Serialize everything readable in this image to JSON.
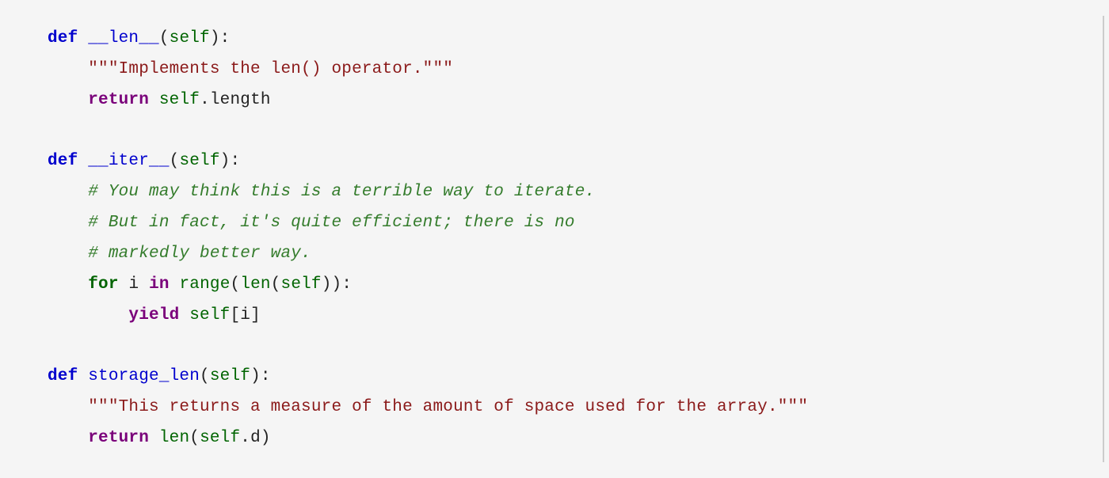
{
  "code": {
    "lines": [
      {
        "indent": 0,
        "tokens": [
          {
            "cls": "tok-def",
            "bind": "code.kw.def"
          },
          {
            "cls": "tok-var",
            "raw": " "
          },
          {
            "cls": "tok-funcname",
            "bind": "code.funcs.len"
          },
          {
            "cls": "tok-paren",
            "raw": "("
          },
          {
            "cls": "tok-self",
            "bind": "code.kw.self"
          },
          {
            "cls": "tok-paren",
            "raw": "):"
          }
        ]
      },
      {
        "indent": 1,
        "tokens": [
          {
            "cls": "tok-docstring",
            "bind": "code.docstrings.len"
          }
        ]
      },
      {
        "indent": 1,
        "tokens": [
          {
            "cls": "tok-ret",
            "bind": "code.kw.return"
          },
          {
            "cls": "tok-var",
            "raw": " "
          },
          {
            "cls": "tok-self",
            "bind": "code.kw.self"
          },
          {
            "cls": "tok-punct",
            "raw": "."
          },
          {
            "cls": "tok-attr",
            "bind": "code.attrs.length"
          }
        ]
      },
      {
        "indent": 0,
        "tokens": []
      },
      {
        "indent": 0,
        "tokens": [
          {
            "cls": "tok-def",
            "bind": "code.kw.def"
          },
          {
            "cls": "tok-var",
            "raw": " "
          },
          {
            "cls": "tok-funcname",
            "bind": "code.funcs.iter"
          },
          {
            "cls": "tok-paren",
            "raw": "("
          },
          {
            "cls": "tok-self",
            "bind": "code.kw.self"
          },
          {
            "cls": "tok-paren",
            "raw": "):"
          }
        ]
      },
      {
        "indent": 1,
        "tokens": [
          {
            "cls": "tok-comment",
            "bind": "code.comments.iter1"
          }
        ]
      },
      {
        "indent": 1,
        "tokens": [
          {
            "cls": "tok-comment",
            "bind": "code.comments.iter2"
          }
        ]
      },
      {
        "indent": 1,
        "tokens": [
          {
            "cls": "tok-comment",
            "bind": "code.comments.iter3"
          }
        ]
      },
      {
        "indent": 1,
        "tokens": [
          {
            "cls": "tok-for",
            "bind": "code.kw.for"
          },
          {
            "cls": "tok-var",
            "raw": " "
          },
          {
            "cls": "tok-var",
            "bind": "code.vars.i"
          },
          {
            "cls": "tok-var",
            "raw": " "
          },
          {
            "cls": "tok-in",
            "bind": "code.kw.in"
          },
          {
            "cls": "tok-var",
            "raw": " "
          },
          {
            "cls": "tok-builtin",
            "bind": "code.builtins.range"
          },
          {
            "cls": "tok-paren",
            "raw": "("
          },
          {
            "cls": "tok-builtin",
            "bind": "code.builtins.len"
          },
          {
            "cls": "tok-paren",
            "raw": "("
          },
          {
            "cls": "tok-self",
            "bind": "code.kw.self"
          },
          {
            "cls": "tok-paren",
            "raw": ")):"
          }
        ]
      },
      {
        "indent": 2,
        "tokens": [
          {
            "cls": "tok-yield",
            "bind": "code.kw.yield"
          },
          {
            "cls": "tok-var",
            "raw": " "
          },
          {
            "cls": "tok-self",
            "bind": "code.kw.self"
          },
          {
            "cls": "tok-paren",
            "raw": "["
          },
          {
            "cls": "tok-var",
            "bind": "code.vars.i"
          },
          {
            "cls": "tok-paren",
            "raw": "]"
          }
        ]
      },
      {
        "indent": 0,
        "tokens": []
      },
      {
        "indent": 0,
        "tokens": [
          {
            "cls": "tok-def",
            "bind": "code.kw.def"
          },
          {
            "cls": "tok-var",
            "raw": " "
          },
          {
            "cls": "tok-funcname",
            "bind": "code.funcs.storage_len"
          },
          {
            "cls": "tok-paren",
            "raw": "("
          },
          {
            "cls": "tok-self",
            "bind": "code.kw.self"
          },
          {
            "cls": "tok-paren",
            "raw": "):"
          }
        ]
      },
      {
        "indent": 1,
        "tokens": [
          {
            "cls": "tok-docstring",
            "bind": "code.docstrings.storage_len"
          }
        ]
      },
      {
        "indent": 1,
        "tokens": [
          {
            "cls": "tok-ret",
            "bind": "code.kw.return"
          },
          {
            "cls": "tok-var",
            "raw": " "
          },
          {
            "cls": "tok-builtin",
            "bind": "code.builtins.len"
          },
          {
            "cls": "tok-paren",
            "raw": "("
          },
          {
            "cls": "tok-self",
            "bind": "code.kw.self"
          },
          {
            "cls": "tok-punct",
            "raw": "."
          },
          {
            "cls": "tok-attr",
            "bind": "code.attrs.d"
          },
          {
            "cls": "tok-paren",
            "raw": ")"
          }
        ]
      }
    ],
    "kw": {
      "def": "def",
      "self": "self",
      "return": "return",
      "for": "for",
      "in": "in",
      "yield": "yield"
    },
    "funcs": {
      "len": "__len__",
      "iter": "__iter__",
      "storage_len": "storage_len"
    },
    "docstrings": {
      "len": "\"\"\"Implements the len() operator.\"\"\"",
      "storage_len": "\"\"\"This returns a measure of the amount of space used for the array.\"\"\""
    },
    "comments": {
      "iter1": "# You may think this is a terrible way to iterate.",
      "iter2": "# But in fact, it's quite efficient; there is no",
      "iter3": "# markedly better way."
    },
    "builtins": {
      "range": "range",
      "len": "len"
    },
    "vars": {
      "i": "i"
    },
    "attrs": {
      "length": "length",
      "d": "d"
    }
  },
  "indent_unit": "    "
}
